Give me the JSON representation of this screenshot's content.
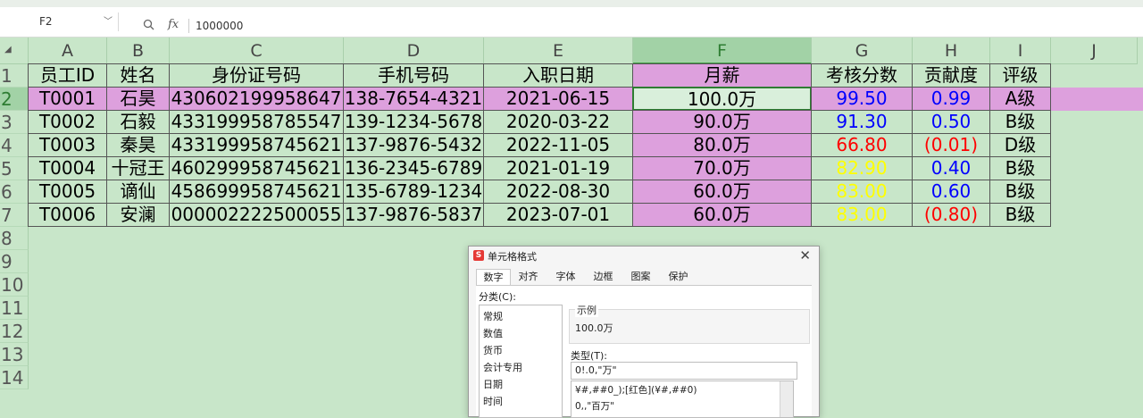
{
  "formula_bar": {
    "name_box": "F2",
    "content": "1000000"
  },
  "columns": [
    "A",
    "B",
    "C",
    "D",
    "E",
    "F",
    "G",
    "H",
    "I",
    "J"
  ],
  "rows": [
    "1",
    "2",
    "3",
    "4",
    "5",
    "6",
    "7",
    "8",
    "9",
    "10",
    "11",
    "12",
    "13",
    "14"
  ],
  "table": {
    "headers": [
      "员工ID",
      "姓名",
      "身份证号码",
      "手机号码",
      "入职日期",
      "月薪",
      "考核分数",
      "贡献度",
      "评级"
    ],
    "data": [
      [
        "T0001",
        "石昊",
        "430602199958647",
        "138-7654-4321",
        "2021-06-15",
        "100.0万",
        "99.50",
        "0.99",
        "A级"
      ],
      [
        "T0002",
        "石毅",
        "433199958785547",
        "139-1234-5678",
        "2020-03-22",
        "90.0万",
        "91.30",
        "0.50",
        "B级"
      ],
      [
        "T0003",
        "秦昊",
        "433199958745621",
        "137-9876-5432",
        "2022-11-05",
        "80.0万",
        "66.80",
        "(0.01)",
        "D级"
      ],
      [
        "T0004",
        "十冠王",
        "460299958745621",
        "136-2345-6789",
        "2021-01-19",
        "70.0万",
        "82.90",
        "0.40",
        "B级"
      ],
      [
        "T0005",
        "谪仙",
        "458699958745621",
        "135-6789-1234",
        "2022-08-30",
        "60.0万",
        "83.00",
        "0.60",
        "B级"
      ],
      [
        "T0006",
        "安澜",
        "000002222500055",
        "137-9876-5837",
        "2023-07-01",
        "60.0万",
        "83.00",
        "(0.80)",
        "B级"
      ]
    ]
  },
  "colors": {
    "grid_background": "#c8e6c9",
    "highlight_pink": "#dda0dd",
    "score_colors": [
      "#0000ff",
      "#0000ff",
      "#ff0000",
      "#ffff00",
      "#ffff00",
      "#ffff00"
    ],
    "contribution_colors": [
      "#0000ff",
      "#0000ff",
      "#ff0000",
      "#0000ff",
      "#0000ff",
      "#ff0000"
    ]
  },
  "dialog": {
    "logo": "S",
    "title": "单元格格式",
    "close": "✕",
    "tabs": [
      "数字",
      "对齐",
      "字体",
      "边框",
      "图案",
      "保护"
    ],
    "category_label": "分类(C):",
    "categories": [
      "常规",
      "数值",
      "货币",
      "会计专用",
      "日期",
      "时间"
    ],
    "sample_label": "示例",
    "sample_value": "100.0万",
    "type_label": "类型(T):",
    "type_value": "0!.0,\"万\"",
    "type_options": [
      "¥#,##0_);[红色](¥#,##0)",
      "0,,\"百万\""
    ]
  }
}
